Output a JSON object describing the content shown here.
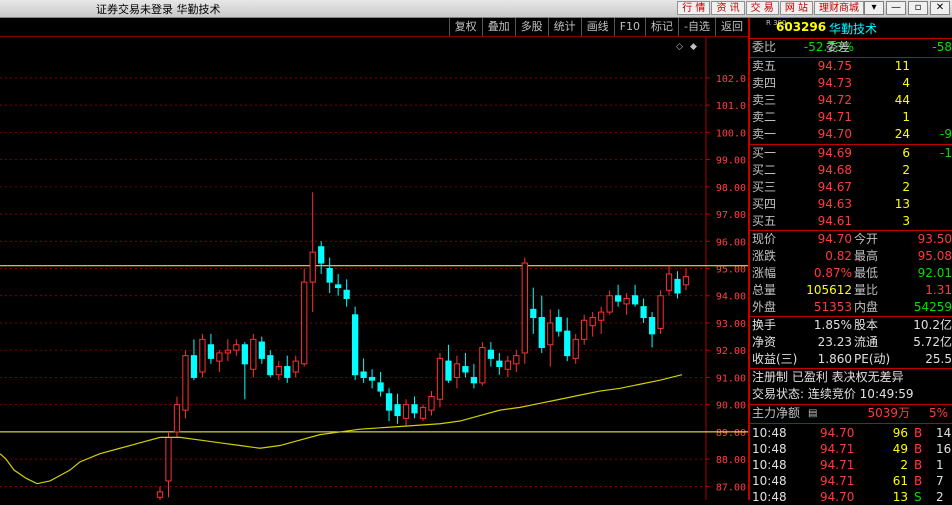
{
  "window": {
    "title": "证券交易未登录  华勤技术",
    "top_buttons": [
      "行 情",
      "资 讯",
      "交 易",
      "网 站",
      "理财商城"
    ],
    "controls": [
      "▾",
      "—",
      "▫",
      "✕"
    ]
  },
  "toolbar": {
    "buttons": [
      "复权",
      "叠加",
      "多股",
      "统计",
      "画线",
      "F10",
      "标记",
      "-自选",
      "返回"
    ]
  },
  "chart_data": {
    "type": "candlestick",
    "y_ticks": [
      102,
      101,
      100,
      99,
      98,
      97,
      96,
      95,
      94,
      93,
      92,
      91,
      90,
      89,
      88,
      87
    ],
    "y_tick_labels": [
      "102.0",
      "101.0",
      "100.0",
      "99.00",
      "98.00",
      "97.00",
      "96.00",
      "95.00",
      "94.00",
      "93.00",
      "92.00",
      "91.00",
      "90.00",
      "89.00",
      "88.00",
      "87.00"
    ],
    "ylim": [
      86.5,
      103.5
    ],
    "hlines": [
      95.1,
      89.0
    ],
    "candles": [
      [
        86.6,
        87.0,
        86.2,
        86.8
      ],
      [
        87.2,
        89.0,
        86.6,
        88.8
      ],
      [
        89.0,
        90.3,
        88.8,
        90.0
      ],
      [
        89.8,
        92.0,
        89.5,
        91.8
      ],
      [
        91.8,
        92.4,
        90.9,
        91.0
      ],
      [
        91.2,
        92.6,
        91.0,
        92.4
      ],
      [
        92.2,
        92.6,
        91.5,
        91.7
      ],
      [
        91.6,
        92.0,
        91.2,
        91.9
      ],
      [
        91.9,
        92.4,
        91.6,
        92.0
      ],
      [
        92.0,
        92.4,
        91.8,
        92.2
      ],
      [
        92.2,
        92.3,
        90.2,
        91.5
      ],
      [
        91.3,
        92.6,
        91.0,
        92.4
      ],
      [
        92.3,
        92.5,
        91.5,
        91.7
      ],
      [
        91.8,
        92.0,
        91.0,
        91.1
      ],
      [
        91.1,
        91.6,
        90.9,
        91.4
      ],
      [
        91.4,
        91.8,
        90.8,
        91.0
      ],
      [
        91.2,
        91.8,
        91.0,
        91.6
      ],
      [
        91.5,
        95.0,
        91.4,
        94.5
      ],
      [
        94.5,
        97.8,
        93.4,
        95.6
      ],
      [
        95.8,
        96.0,
        94.8,
        95.2
      ],
      [
        95.0,
        95.4,
        94.1,
        94.5
      ],
      [
        94.4,
        94.8,
        94.0,
        94.3
      ],
      [
        94.2,
        94.6,
        93.6,
        93.9
      ],
      [
        93.3,
        93.6,
        90.9,
        91.1
      ],
      [
        91.2,
        91.7,
        90.8,
        91.0
      ],
      [
        91.0,
        91.3,
        90.6,
        90.9
      ],
      [
        90.8,
        91.2,
        90.3,
        90.5
      ],
      [
        90.4,
        90.6,
        89.4,
        89.8
      ],
      [
        90.0,
        90.4,
        89.3,
        89.6
      ],
      [
        89.5,
        90.2,
        89.2,
        90.0
      ],
      [
        90.0,
        90.3,
        89.5,
        89.7
      ],
      [
        89.5,
        90.0,
        89.4,
        89.9
      ],
      [
        89.8,
        90.5,
        89.6,
        90.3
      ],
      [
        90.2,
        91.9,
        89.9,
        91.7
      ],
      [
        91.6,
        92.2,
        90.8,
        90.9
      ],
      [
        91.0,
        91.8,
        90.6,
        91.5
      ],
      [
        91.4,
        91.9,
        91.0,
        91.2
      ],
      [
        91.0,
        91.5,
        90.6,
        90.8
      ],
      [
        90.8,
        92.3,
        90.7,
        92.1
      ],
      [
        92.0,
        92.3,
        91.4,
        91.7
      ],
      [
        91.6,
        91.9,
        91.1,
        91.4
      ],
      [
        91.3,
        91.8,
        91.0,
        91.6
      ],
      [
        91.5,
        92.0,
        91.2,
        91.8
      ],
      [
        91.9,
        95.4,
        91.5,
        95.2
      ],
      [
        93.5,
        94.3,
        92.6,
        93.2
      ],
      [
        93.2,
        94.0,
        91.9,
        92.1
      ],
      [
        92.2,
        93.5,
        91.4,
        93.0
      ],
      [
        93.2,
        93.5,
        92.5,
        92.7
      ],
      [
        92.7,
        93.2,
        91.6,
        91.8
      ],
      [
        91.7,
        92.6,
        91.5,
        92.4
      ],
      [
        92.4,
        93.3,
        92.2,
        93.1
      ],
      [
        92.9,
        93.4,
        92.5,
        93.2
      ],
      [
        93.1,
        93.6,
        92.6,
        93.4
      ],
      [
        93.4,
        94.2,
        93.3,
        94.0
      ],
      [
        94.0,
        94.4,
        93.6,
        93.8
      ],
      [
        93.7,
        94.1,
        93.3,
        93.9
      ],
      [
        94.0,
        94.4,
        93.6,
        93.7
      ],
      [
        93.6,
        93.9,
        93.0,
        93.2
      ],
      [
        93.2,
        93.4,
        92.1,
        92.6
      ],
      [
        92.8,
        94.2,
        92.6,
        94.0
      ],
      [
        94.2,
        95.1,
        94.0,
        94.8
      ],
      [
        94.6,
        94.9,
        93.9,
        94.1
      ],
      [
        94.4,
        95.0,
        94.2,
        94.7
      ]
    ],
    "ma": [
      [
        0,
        88.2
      ],
      [
        6,
        88.0
      ],
      [
        14,
        87.6
      ],
      [
        26,
        87.3
      ],
      [
        37,
        87.1
      ],
      [
        50,
        87.2
      ],
      [
        60,
        87.4
      ],
      [
        70,
        87.6
      ],
      [
        80,
        87.9
      ],
      [
        100,
        88.2
      ],
      [
        120,
        88.4
      ],
      [
        140,
        88.6
      ],
      [
        160,
        88.8
      ],
      [
        180,
        88.8
      ],
      [
        200,
        88.7
      ],
      [
        220,
        88.6
      ],
      [
        240,
        88.5
      ],
      [
        260,
        88.4
      ],
      [
        280,
        88.5
      ],
      [
        300,
        88.7
      ],
      [
        320,
        88.9
      ],
      [
        340,
        89.0
      ],
      [
        360,
        89.1
      ],
      [
        380,
        89.15
      ],
      [
        400,
        89.2
      ],
      [
        420,
        89.25
      ],
      [
        440,
        89.3
      ],
      [
        460,
        89.4
      ],
      [
        480,
        89.6
      ],
      [
        500,
        89.8
      ],
      [
        520,
        89.9
      ],
      [
        540,
        90.05
      ],
      [
        560,
        90.2
      ],
      [
        580,
        90.35
      ],
      [
        600,
        90.5
      ],
      [
        620,
        90.6
      ],
      [
        640,
        90.75
      ],
      [
        660,
        90.9
      ],
      [
        682,
        91.1
      ]
    ],
    "colors": {
      "up": "#ff3030",
      "down": "#00ffff",
      "ma": "#d0d000",
      "grid": "#b00000",
      "hline": "#ffff60"
    }
  },
  "quote": {
    "r_mark": "R 300",
    "code": "603296",
    "name": "华勤技术",
    "weibi_label": "委比",
    "weibi_value": "-52.73%",
    "weicha_label": "委差",
    "weicha_value": "-58",
    "asks": [
      {
        "label": "卖五",
        "price": "94.75",
        "vol": "11",
        "chg": ""
      },
      {
        "label": "卖四",
        "price": "94.73",
        "vol": "4",
        "chg": ""
      },
      {
        "label": "卖三",
        "price": "94.72",
        "vol": "44",
        "chg": ""
      },
      {
        "label": "卖二",
        "price": "94.71",
        "vol": "1",
        "chg": ""
      },
      {
        "label": "卖一",
        "price": "94.70",
        "vol": "24",
        "chg": "-9"
      }
    ],
    "bids": [
      {
        "label": "买一",
        "price": "94.69",
        "vol": "6",
        "chg": "-1"
      },
      {
        "label": "买二",
        "price": "94.68",
        "vol": "2",
        "chg": ""
      },
      {
        "label": "买三",
        "price": "94.67",
        "vol": "2",
        "chg": ""
      },
      {
        "label": "买四",
        "price": "94.63",
        "vol": "13",
        "chg": ""
      },
      {
        "label": "买五",
        "price": "94.61",
        "vol": "3",
        "chg": ""
      }
    ],
    "stats": [
      {
        "l1": "现价",
        "v1": "94.70",
        "l2": "今开",
        "v2": "93.50",
        "c1": "red",
        "c2": "red"
      },
      {
        "l1": "涨跌",
        "v1": "0.82",
        "l2": "最高",
        "v2": "95.08",
        "c1": "red",
        "c2": "red"
      },
      {
        "l1": "涨幅",
        "v1": "0.87%",
        "l2": "最低",
        "v2": "92.01",
        "c1": "red",
        "c2": "grn"
      },
      {
        "l1": "总量",
        "v1": "105612",
        "l2": "量比",
        "v2": "1.31",
        "c1": "yel",
        "c2": "red"
      },
      {
        "l1": "外盘",
        "v1": "51353",
        "l2": "内盘",
        "v2": "54259",
        "c1": "red",
        "c2": "grn"
      }
    ],
    "fin": [
      {
        "l1": "换手",
        "v1": "1.85%",
        "l2": "股本",
        "v2": "10.2亿"
      },
      {
        "l1": "净资",
        "v1": "23.23",
        "l2": "流通",
        "v2": "5.72亿"
      },
      {
        "l1": "收益(三)",
        "v1": "1.860",
        "l2": "PE(动)",
        "v2": "25.5"
      }
    ],
    "reg_text": "注册制 已盈利 表决权无差异",
    "status_text": "交易状态: 连续竞价 10:49:59",
    "net_label": "主力净额",
    "net_value": "5039万",
    "net_pct": "5%",
    "ticks": [
      {
        "time": "10:48",
        "price": "94.70",
        "vol": "96",
        "bs": "B",
        "n": "14"
      },
      {
        "time": "10:48",
        "price": "94.71",
        "vol": "49",
        "bs": "B",
        "n": "16"
      },
      {
        "time": "10:48",
        "price": "94.71",
        "vol": "2",
        "bs": "B",
        "n": "1"
      },
      {
        "time": "10:48",
        "price": "94.71",
        "vol": "61",
        "bs": "B",
        "n": "7"
      },
      {
        "time": "10:48",
        "price": "94.70",
        "vol": "13",
        "bs": "S",
        "n": "2"
      }
    ]
  }
}
